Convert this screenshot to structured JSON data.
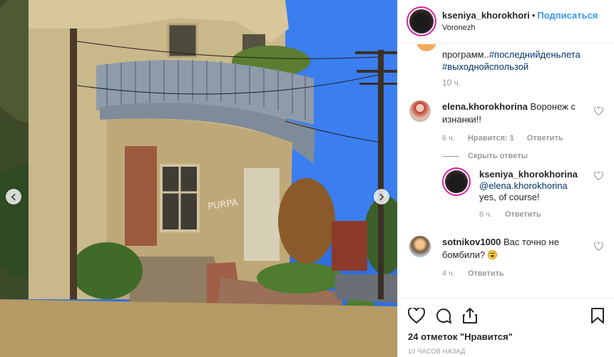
{
  "post": {
    "author": "kseniya_khorokhori",
    "separator": "•",
    "follow_label": "Подписаться",
    "location": "Voronezh"
  },
  "caption_tail": {
    "text": "программ..",
    "hashtags": [
      "#последнийденьлета",
      "#выходнойспользой"
    ],
    "time": "10 ч."
  },
  "comments": [
    {
      "user": "elena.khorokhorina",
      "text": "Воронеж с изнанки!!",
      "time": "6 ч.",
      "likes_label": "Нравится: 1",
      "reply_label": "Ответить",
      "hide_replies_label": "Скрыть ответы",
      "replies": [
        {
          "user": "kseniya_khorokhorina",
          "mention": "@elena.khorokhorina",
          "text": "yes, of course!",
          "time": "6 ч.",
          "reply_label": "Ответить"
        }
      ]
    },
    {
      "user": "sotnikov1000",
      "text": "Вас точно не бомбили?",
      "emoji": "grimacing-face",
      "time": "4 ч.",
      "reply_label": "Ответить"
    }
  ],
  "actions": {
    "icons": [
      "heart-icon",
      "comment-icon",
      "share-icon",
      "bookmark-icon"
    ],
    "likes_text": "24 отметок \"Нравится\"",
    "posted_ago": "10 ЧАСОВ НАЗАД"
  },
  "colors": {
    "link": "#3897f0",
    "hashtag": "#003569",
    "muted": "#999999",
    "story_ring": "#d6249f"
  }
}
